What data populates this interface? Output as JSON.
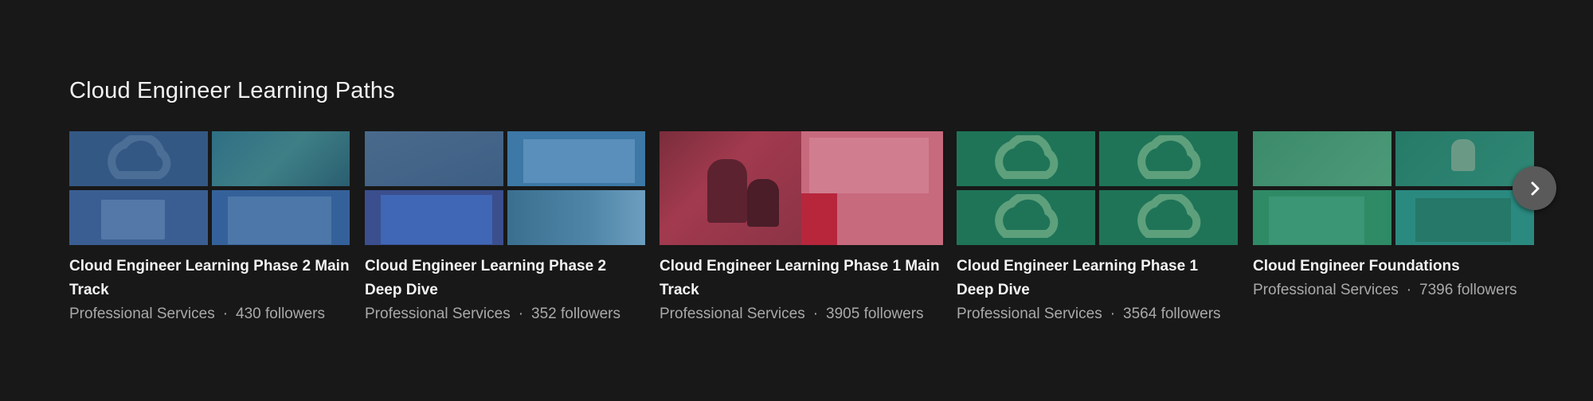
{
  "section": {
    "title": "Cloud Engineer Learning Paths"
  },
  "cards": [
    {
      "title": "Cloud Engineer Learning Phase 2 Main Track",
      "publisher": "Professional Services",
      "followers": "430 followers",
      "tint": "#2d5a8a"
    },
    {
      "title": "Cloud Engineer Learning Phase 2 Deep Dive",
      "publisher": "Professional Services",
      "followers": "352 followers",
      "tint": "#3f6fa8"
    },
    {
      "title": "Cloud Engineer Learning Phase 1 Main Track",
      "publisher": "Professional Services",
      "followers": "3905 followers",
      "tint": "#b23c56"
    },
    {
      "title": "Cloud Engineer Learning Phase 1 Deep Dive",
      "publisher": "Professional Services",
      "followers": "3564 followers",
      "tint": "#1f7a5e"
    },
    {
      "title": "Cloud Engineer Foundations",
      "publisher": "Professional Services",
      "followers": "7396 followers",
      "tint": "#2e8b78"
    }
  ],
  "separator": "·",
  "next_button": {
    "icon": "chevron-right-icon"
  }
}
